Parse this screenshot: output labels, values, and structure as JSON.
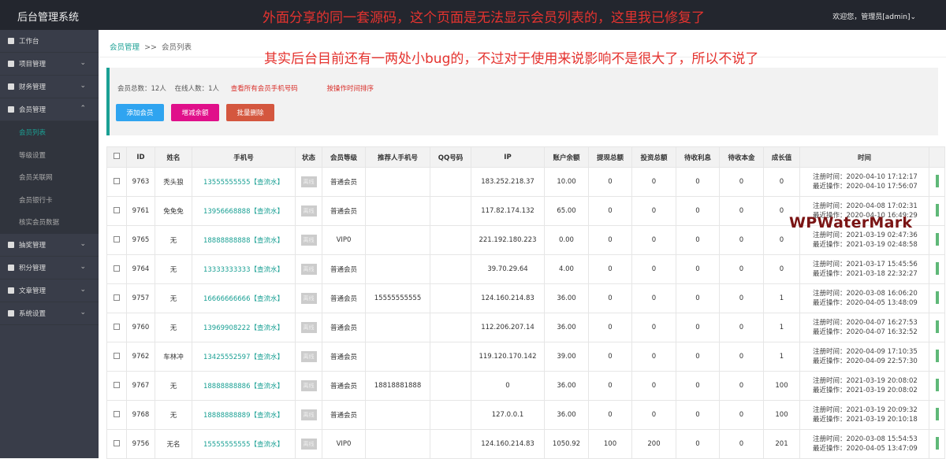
{
  "header": {
    "title": "后台管理系统",
    "user": "欢迎您，管理员[admin]⌄"
  },
  "annotations": [
    "外面分享的同一套源码，这个页面是无法显示会员列表的，这里我已修复了",
    "其实后台目前还有一两处小bug的，不过对于使用来说影响不是很大了，所以不说了"
  ],
  "watermark": "WPWaterMark",
  "sidebar": {
    "items": [
      {
        "label": "工作台",
        "icon": "dashboard-icon",
        "chevron": ""
      },
      {
        "label": "项目管理",
        "icon": "clipboard-icon",
        "chevron": "⌄"
      },
      {
        "label": "财务管理",
        "icon": "finance-icon",
        "chevron": "⌄"
      },
      {
        "label": "会员管理",
        "icon": "member-icon",
        "chevron": "⌃"
      }
    ],
    "sub": [
      "会员列表",
      "等级设置",
      "会员关联网",
      "会员银行卡",
      "核实会员数据"
    ],
    "items2": [
      {
        "label": "抽奖管理",
        "icon": "file-icon",
        "chevron": "⌄"
      },
      {
        "label": "积分管理",
        "icon": "file-icon",
        "chevron": "⌄"
      },
      {
        "label": "文章管理",
        "icon": "file-icon",
        "chevron": "⌄"
      },
      {
        "label": "系统设置",
        "icon": "gear-icon",
        "chevron": "⌄"
      }
    ]
  },
  "breadcrumb": {
    "parent": "会员管理",
    "sep": ">>",
    "current": "会员列表"
  },
  "stats": {
    "total": "会员总数：12人",
    "online": "在线人数：1人",
    "view_phones": "查看所有会员手机号码",
    "sort": "按操作时间排序"
  },
  "buttons": {
    "add": "添加会员",
    "balance": "增减余额",
    "delete": "批量删除"
  },
  "colors": {
    "add": "#2fa4f0",
    "balance": "#e0108a",
    "delete": "#d4573f",
    "accent": "#1aa094"
  },
  "table": {
    "headers": [
      "ID",
      "姓名",
      "手机号",
      "状态",
      "会员等级",
      "推荐人手机号",
      "QQ号码",
      "IP",
      "账户余额",
      "提现总额",
      "投资总额",
      "待收利息",
      "待收本金",
      "成长值",
      "时间"
    ],
    "flow_label": "【查流水】",
    "status": "离线",
    "reg_label": "注册时间：",
    "op_label": "最近操作：",
    "rows": [
      [
        "9763",
        "秃头狼",
        "13555555555",
        "普通会员",
        "",
        "",
        "183.252.218.37",
        "10.00",
        "0",
        "0",
        "0",
        "0",
        "0",
        "2020-04-10 17:12:17",
        "2020-04-10 17:56:07"
      ],
      [
        "9761",
        "免免免",
        "13956668888",
        "普通会员",
        "",
        "",
        "117.82.174.132",
        "65.00",
        "0",
        "0",
        "0",
        "0",
        "0",
        "2020-04-08 17:02:31",
        "2020-04-10 16:49:29"
      ],
      [
        "9765",
        "无",
        "18888888888",
        "VIP0",
        "",
        "",
        "221.192.180.223",
        "0.00",
        "0",
        "0",
        "0",
        "0",
        "0",
        "2021-03-19 02:47:36",
        "2021-03-19 02:48:58"
      ],
      [
        "9764",
        "无",
        "13333333333",
        "普通会员",
        "",
        "",
        "39.70.29.64",
        "4.00",
        "0",
        "0",
        "0",
        "0",
        "0",
        "2021-03-17 15:45:56",
        "2021-03-18 22:32:27"
      ],
      [
        "9757",
        "无",
        "16666666666",
        "普通会员",
        "15555555555",
        "",
        "124.160.214.83",
        "36.00",
        "0",
        "0",
        "0",
        "0",
        "1",
        "2020-03-08 16:06:20",
        "2020-04-05 13:48:09"
      ],
      [
        "9760",
        "无",
        "13969908222",
        "普通会员",
        "",
        "",
        "112.206.207.14",
        "36.00",
        "0",
        "0",
        "0",
        "0",
        "1",
        "2020-04-07 16:27:53",
        "2020-04-07 16:32:52"
      ],
      [
        "9762",
        "车林冲",
        "13425552597",
        "普通会员",
        "",
        "",
        "119.120.170.142",
        "39.00",
        "0",
        "0",
        "0",
        "0",
        "1",
        "2020-04-09 17:10:35",
        "2020-04-09 22:57:30"
      ],
      [
        "9767",
        "无",
        "18888888886",
        "普通会员",
        "18818881888",
        "",
        "0",
        "36.00",
        "0",
        "0",
        "0",
        "0",
        "100",
        "2021-03-19 20:08:02",
        "2021-03-19 20:08:02"
      ],
      [
        "9768",
        "无",
        "18888888889",
        "普通会员",
        "",
        "",
        "127.0.0.1",
        "36.00",
        "0",
        "0",
        "0",
        "0",
        "100",
        "2021-03-19 20:09:32",
        "2021-03-19 20:10:18"
      ],
      [
        "9756",
        "无名",
        "15555555555",
        "VIP0",
        "",
        "",
        "124.160.214.83",
        "1050.92",
        "100",
        "200",
        "0",
        "0",
        "201",
        "2020-03-08 15:54:53",
        "2020-04-05 13:47:09"
      ]
    ]
  }
}
